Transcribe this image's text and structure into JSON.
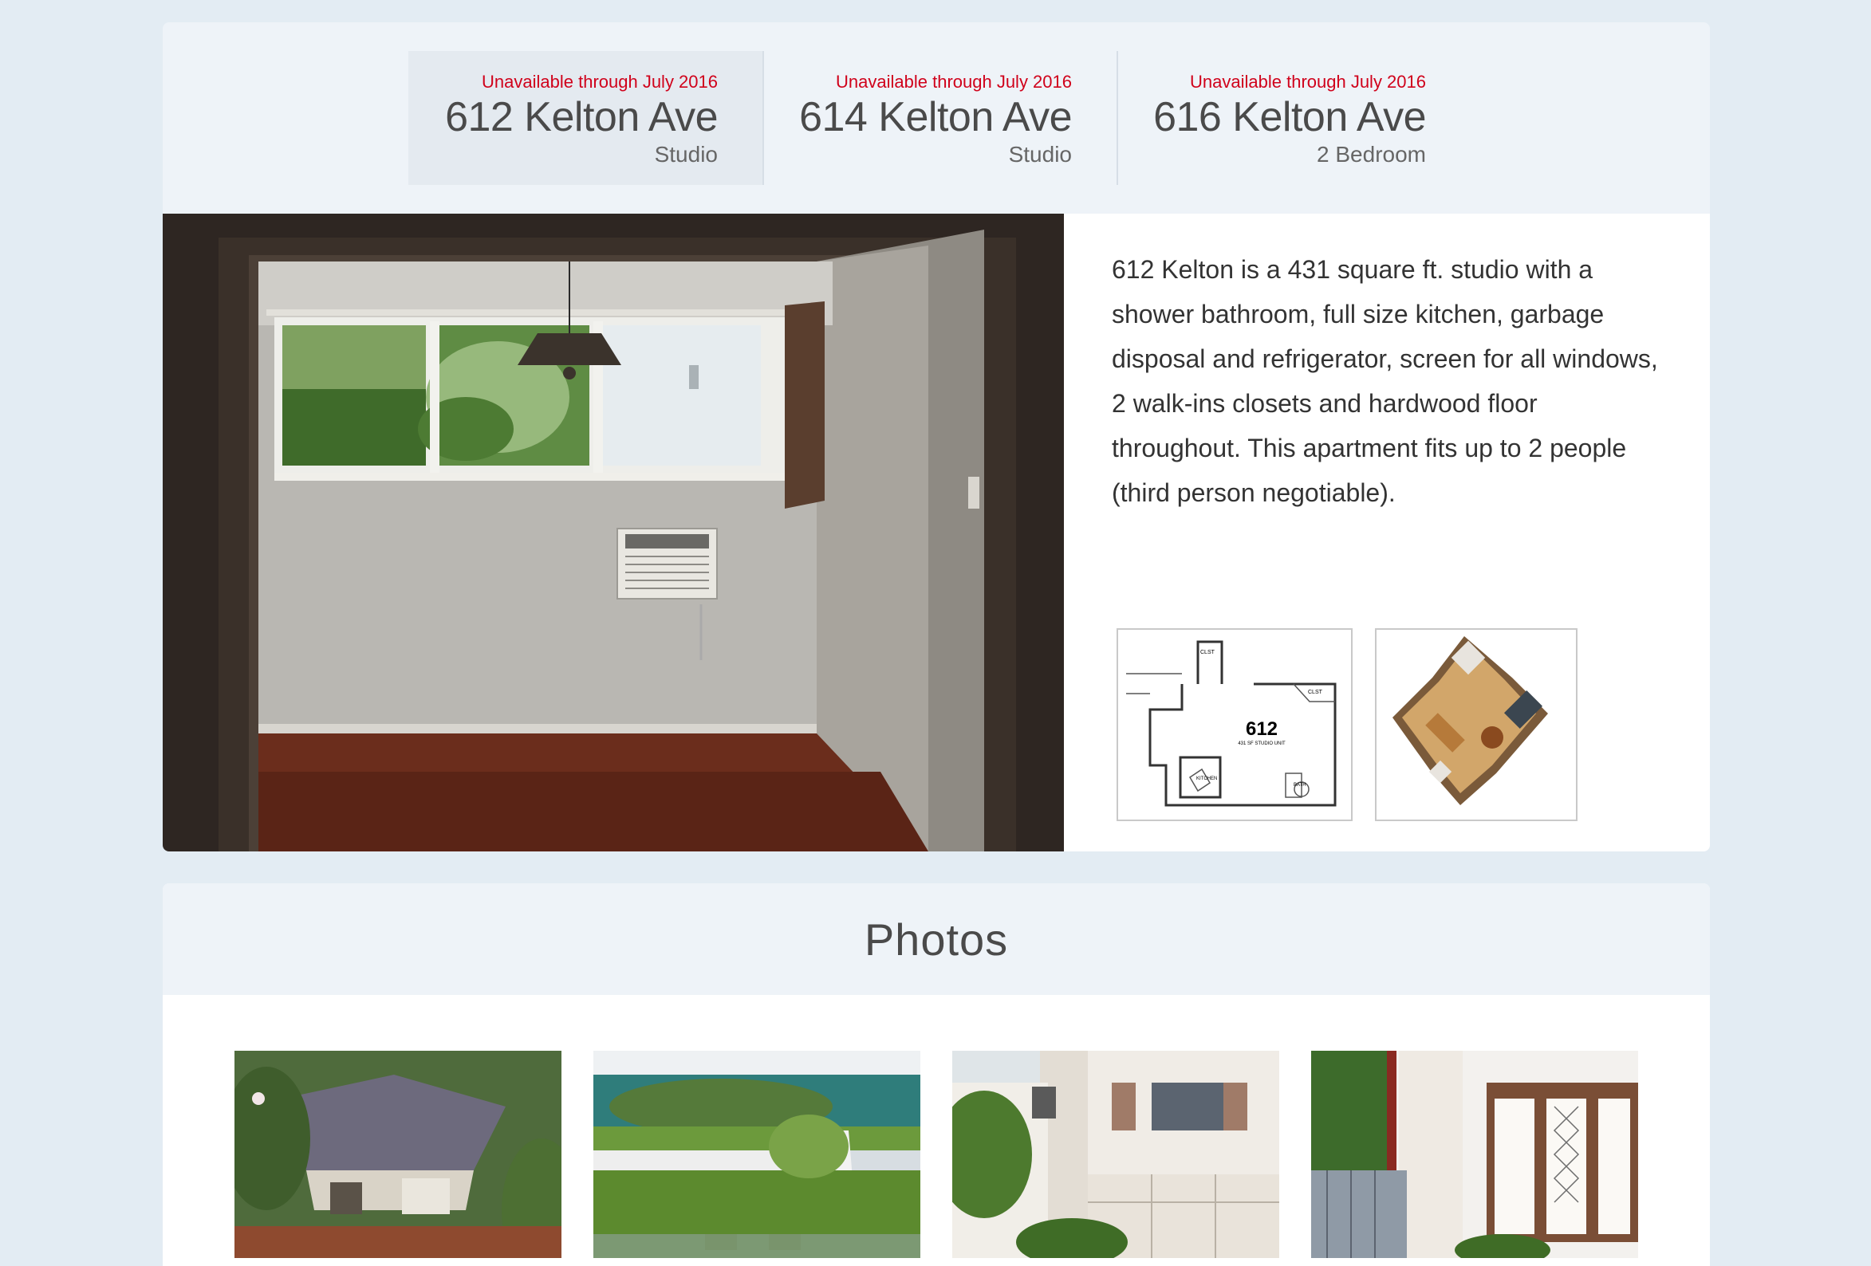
{
  "units": [
    {
      "status": "Unavailable through July 2016",
      "address": "612 Kelton Ave",
      "type": "Studio"
    },
    {
      "status": "Unavailable through July 2016",
      "address": "614 Kelton Ave",
      "type": "Studio"
    },
    {
      "status": "Unavailable through July 2016",
      "address": "616 Kelton Ave",
      "type": "2 Bedroom"
    }
  ],
  "detail": {
    "description": "612 Kelton is a 431 square ft. studio with a shower bathroom, full size kitchen, garbage disposal and refrigerator, screen for all windows, 2 walk-ins closets and hardwood floor throughout. This apartment fits up to 2 people (third person negotiable).",
    "floorplan": {
      "unit_number": "612",
      "caption": "431 SF STUDIO UNIT",
      "labels": [
        "CLST",
        "CLST",
        "KITCHEN",
        "BATH"
      ]
    }
  },
  "photos": {
    "title": "Photos"
  },
  "colors": {
    "status": "#d0021b",
    "background": "#e3ecf3",
    "card_header": "#eef3f8"
  }
}
